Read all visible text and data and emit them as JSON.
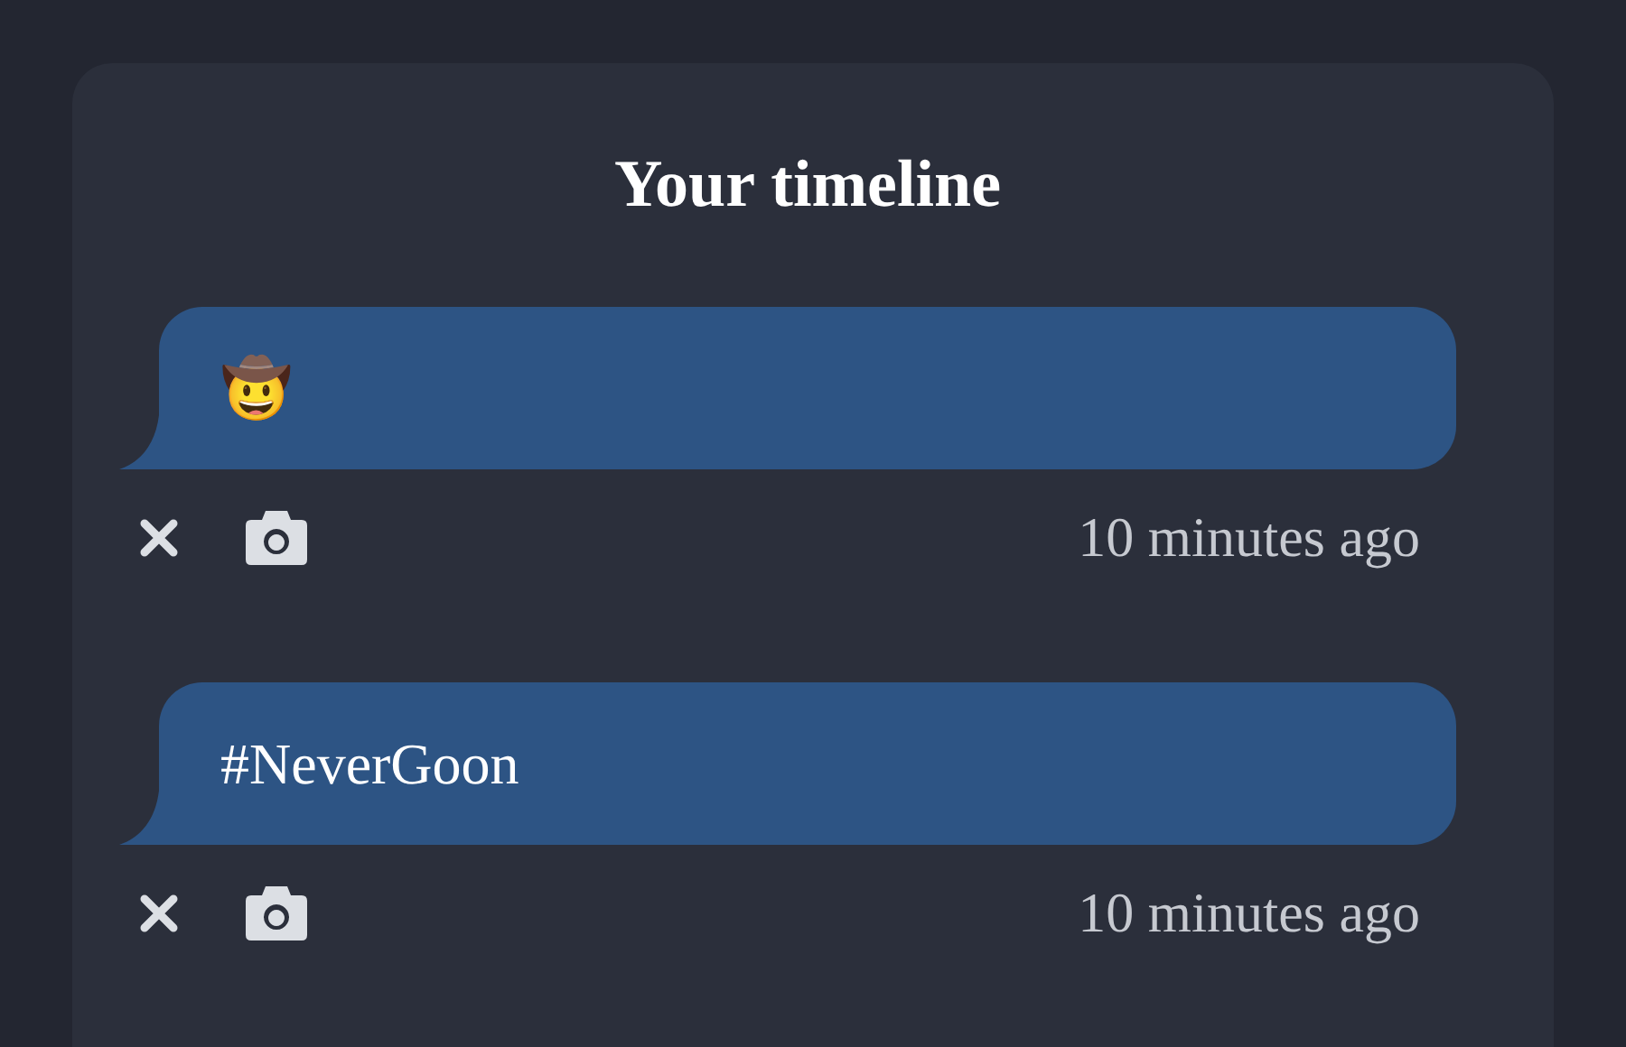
{
  "title": "Your timeline",
  "posts": [
    {
      "text": "🤠",
      "time": "10 minutes ago"
    },
    {
      "text": "#NeverGoon",
      "time": "10 minutes ago"
    }
  ]
}
